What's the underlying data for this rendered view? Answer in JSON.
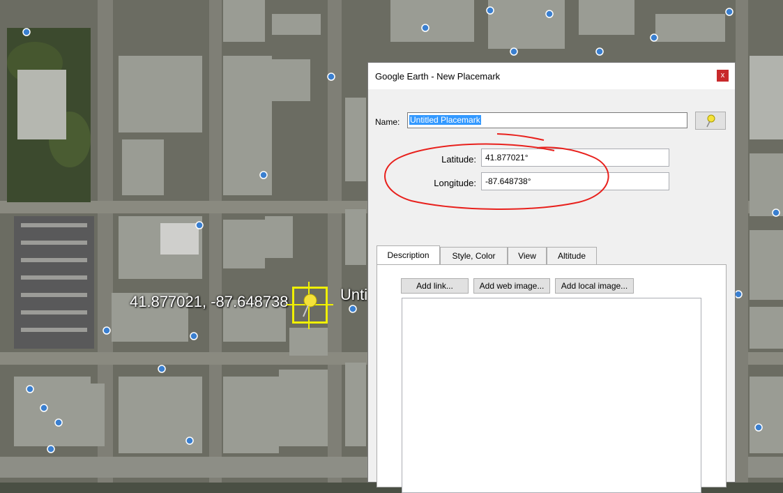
{
  "map": {
    "coordinate_label": "41.877021, -87.648738",
    "placemark_label": "Untitled Placemark"
  },
  "dialog": {
    "title": "Google Earth - New Placemark",
    "close_label": "x",
    "name_label": "Name:",
    "name_value": "Untitled Placemark",
    "latitude_label": "Latitude:",
    "latitude_value": "41.877021°",
    "longitude_label": "Longitude:",
    "longitude_value": "-87.648738°",
    "tabs": [
      {
        "label": "Description"
      },
      {
        "label": "Style, Color"
      },
      {
        "label": "View"
      },
      {
        "label": "Altitude"
      }
    ],
    "buttons": {
      "add_link": "Add link...",
      "add_web_image": "Add web image...",
      "add_local_image": "Add local image..."
    }
  },
  "colors": {
    "annotation": "#e8201c",
    "pin": "#f0f000",
    "selection": "#3399ff",
    "close": "#c8292b"
  }
}
